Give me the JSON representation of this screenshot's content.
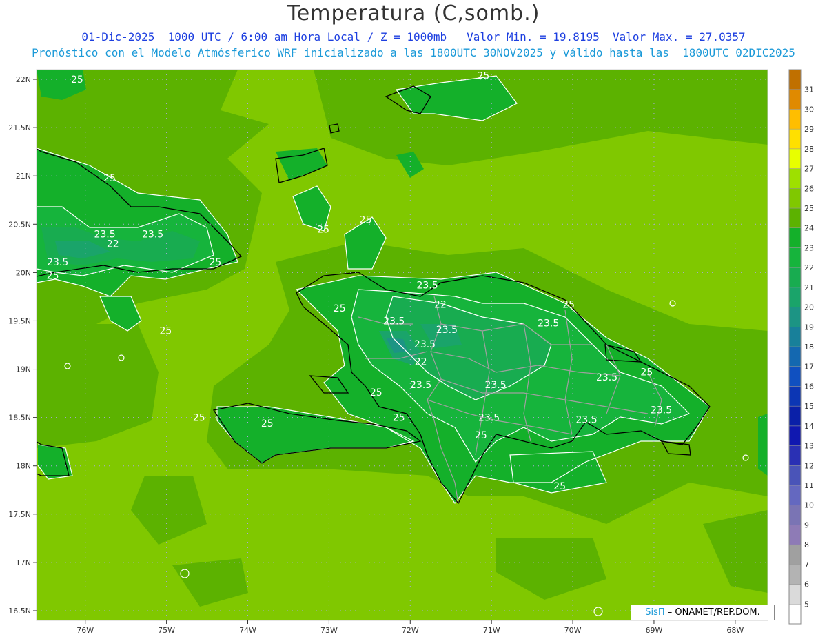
{
  "title": "Temperatura (C,somb.)",
  "subtitle_line1": "01-Dic-2025  1000 UTC / 6:00 am Hora Local / Z = 1000mb   Valor Min. = 19.8195  Valor Max. = 27.0357",
  "subtitle_line2": "Pronóstico con el Modelo Atmósferico WRF inicializado a las 1800UTC_30NOV2025 y válido hasta las  1800UTC_02DIC2025",
  "credit": {
    "sis": "SisΠ",
    "rest": " – ONAMET/REP.DOM."
  },
  "axes": {
    "lat_labels": [
      "22N",
      "21.5N",
      "21N",
      "20.5N",
      "20N",
      "19.5N",
      "19N",
      "18.5N",
      "18N",
      "17.5N",
      "17N",
      "16.5N"
    ],
    "lat_values": [
      22,
      21.5,
      21,
      20.5,
      20,
      19.5,
      19,
      18.5,
      18,
      17.5,
      17,
      16.5
    ],
    "lon_labels": [
      "76W",
      "75W",
      "74W",
      "73W",
      "72W",
      "71W",
      "70W",
      "69W",
      "68W"
    ],
    "lon_values": [
      -76,
      -75,
      -74,
      -73,
      -72,
      -71,
      -70,
      -69,
      -68
    ],
    "lat_range": [
      16.4,
      22.1
    ],
    "lon_range": [
      -76.6,
      -67.6
    ]
  },
  "colorbar": {
    "levels": [
      5,
      6,
      7,
      8,
      9,
      10,
      11,
      12,
      13,
      14,
      15,
      16,
      17,
      18,
      19,
      20,
      21,
      22,
      23,
      24,
      25,
      26,
      27,
      28,
      29,
      30,
      31
    ],
    "colors": [
      "#ffffff",
      "#dadada",
      "#b3b3b3",
      "#a0a0a0",
      "#8e7bb6",
      "#7a74b4",
      "#6468c0",
      "#4a54b8",
      "#2a30b4",
      "#1018b0",
      "#0a20a8",
      "#0c36b4",
      "#1050c0",
      "#1468b0",
      "#18809a",
      "#1c9484",
      "#1aa46a",
      "#18ac50",
      "#16b43c",
      "#14b02a",
      "#5cb200",
      "#80c800",
      "#9ee000",
      "#e8ff00",
      "#ffe000",
      "#ffbe00",
      "#e08a00",
      "#c07000"
    ]
  },
  "contour_labels": [
    {
      "text": "25",
      "lon": -76.1,
      "lat": 22.0
    },
    {
      "text": "25",
      "lon": -71.1,
      "lat": 22.04
    },
    {
      "text": "25",
      "lon": -75.7,
      "lat": 20.98
    },
    {
      "text": "25",
      "lon": -73.07,
      "lat": 20.45
    },
    {
      "text": "25",
      "lon": -72.55,
      "lat": 20.55
    },
    {
      "text": "23.5",
      "lon": -75.76,
      "lat": 20.4
    },
    {
      "text": "23.5",
      "lon": -75.17,
      "lat": 20.4
    },
    {
      "text": "22",
      "lon": -75.66,
      "lat": 20.3
    },
    {
      "text": "23.5",
      "lon": -76.34,
      "lat": 20.11
    },
    {
      "text": "25",
      "lon": -74.4,
      "lat": 20.11
    },
    {
      "text": "25",
      "lon": -76.4,
      "lat": 19.97
    },
    {
      "text": "25",
      "lon": -75.01,
      "lat": 19.4
    },
    {
      "text": "23.5",
      "lon": -71.79,
      "lat": 19.87
    },
    {
      "text": "22",
      "lon": -71.63,
      "lat": 19.67
    },
    {
      "text": "25",
      "lon": -72.87,
      "lat": 19.63
    },
    {
      "text": "25",
      "lon": -70.05,
      "lat": 19.67
    },
    {
      "text": "23.5",
      "lon": -72.2,
      "lat": 19.5
    },
    {
      "text": "23.5",
      "lon": -71.55,
      "lat": 19.41
    },
    {
      "text": "23.5",
      "lon": -70.3,
      "lat": 19.48
    },
    {
      "text": "23.5",
      "lon": -71.82,
      "lat": 19.26
    },
    {
      "text": "22",
      "lon": -71.87,
      "lat": 19.08
    },
    {
      "text": "23.5",
      "lon": -69.58,
      "lat": 18.92
    },
    {
      "text": "25",
      "lon": -69.09,
      "lat": 18.97
    },
    {
      "text": "23.5",
      "lon": -71.87,
      "lat": 18.84
    },
    {
      "text": "23.5",
      "lon": -70.95,
      "lat": 18.84
    },
    {
      "text": "25",
      "lon": -72.42,
      "lat": 18.76
    },
    {
      "text": "23.5",
      "lon": -68.91,
      "lat": 18.58
    },
    {
      "text": "23.5",
      "lon": -71.03,
      "lat": 18.5
    },
    {
      "text": "23.5",
      "lon": -69.83,
      "lat": 18.48
    },
    {
      "text": "25",
      "lon": -74.6,
      "lat": 18.5
    },
    {
      "text": "25",
      "lon": -72.14,
      "lat": 18.5
    },
    {
      "text": "25",
      "lon": -73.76,
      "lat": 18.44
    },
    {
      "text": "25",
      "lon": -71.13,
      "lat": 18.32
    },
    {
      "text": "25",
      "lon": -70.16,
      "lat": 17.79
    }
  ]
}
